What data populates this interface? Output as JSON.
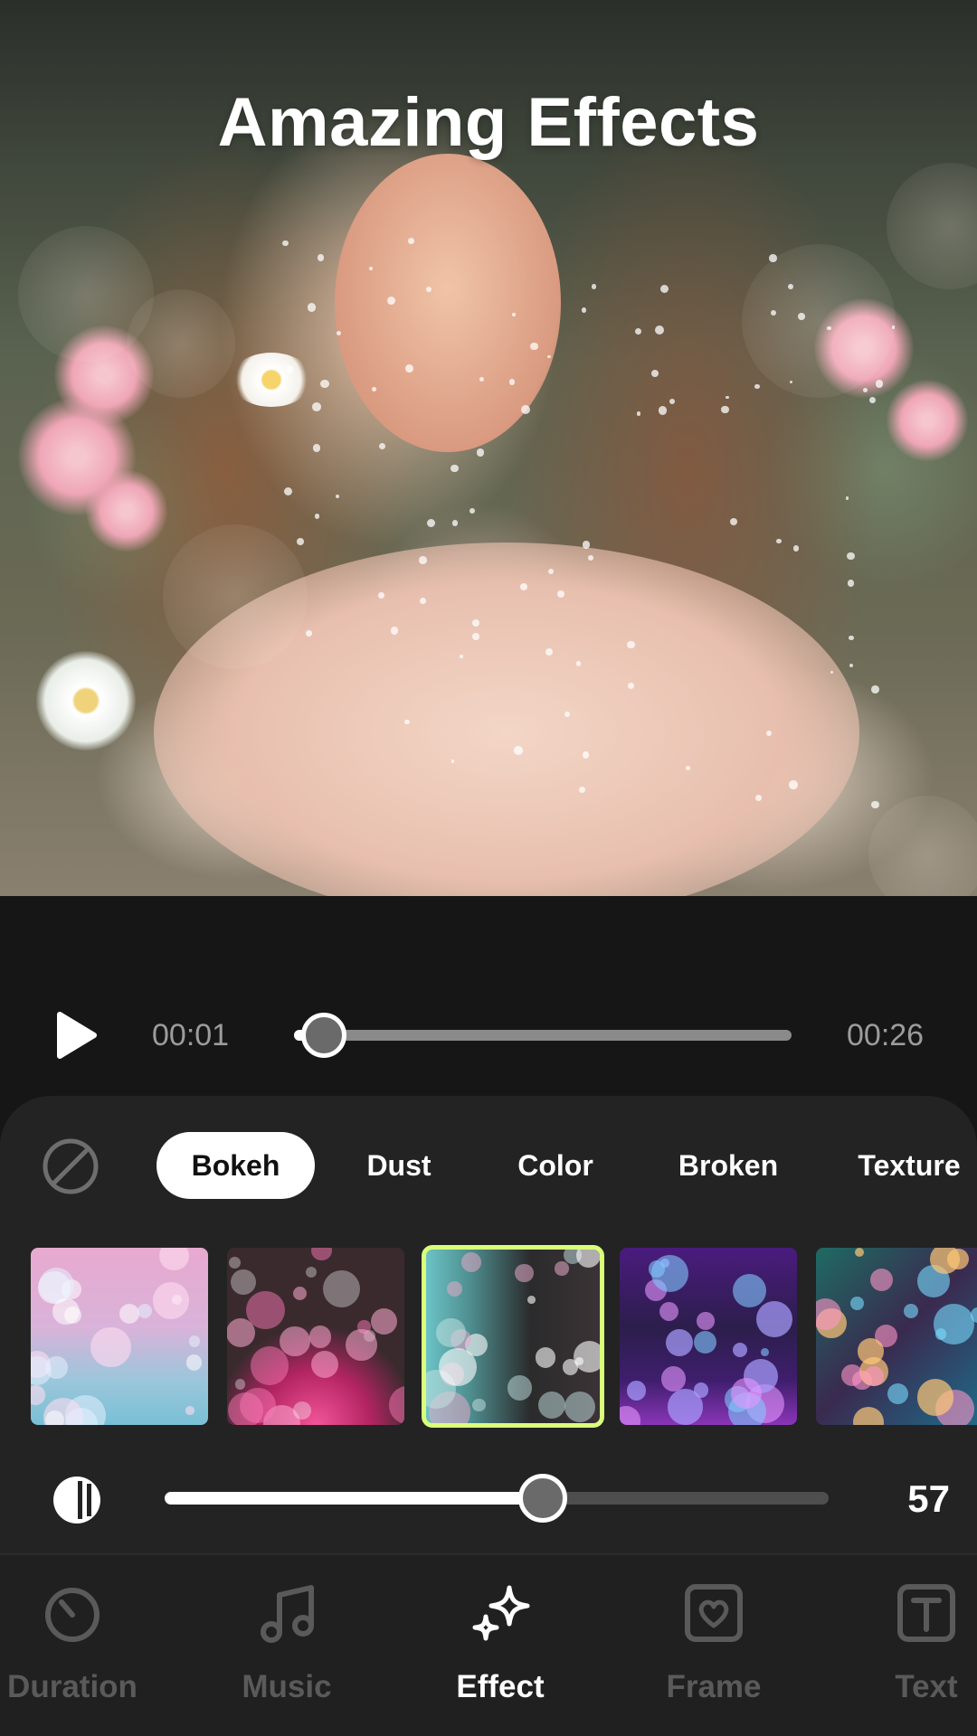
{
  "preview": {
    "title": "Amazing Effects"
  },
  "playback": {
    "current_time": "00:01",
    "total_time": "00:26",
    "progress": 0.06
  },
  "effects": {
    "categories": [
      {
        "label": "Bokeh",
        "active": true
      },
      {
        "label": "Dust",
        "active": false
      },
      {
        "label": "Color",
        "active": false
      },
      {
        "label": "Broken",
        "active": false
      },
      {
        "label": "Texture",
        "active": false
      }
    ],
    "presets": [
      {
        "name": "bokeh-pastel-preset",
        "selected": false
      },
      {
        "name": "bokeh-pink-preset",
        "selected": false
      },
      {
        "name": "bokeh-teal-preset",
        "selected": true
      },
      {
        "name": "bokeh-purple-preset",
        "selected": false
      },
      {
        "name": "bokeh-rainbow-preset",
        "selected": false
      }
    ],
    "selected_accent": "#d9ff7a",
    "intensity": 57,
    "intensity_max": 100
  },
  "nav": {
    "items": [
      {
        "label": "Duration",
        "icon": "timer-icon",
        "active": false
      },
      {
        "label": "Music",
        "icon": "music-note-icon",
        "active": false
      },
      {
        "label": "Effect",
        "icon": "sparkle-icon",
        "active": true
      },
      {
        "label": "Frame",
        "icon": "heart-frame-icon",
        "active": false
      },
      {
        "label": "Text",
        "icon": "text-box-icon",
        "active": false
      }
    ]
  }
}
